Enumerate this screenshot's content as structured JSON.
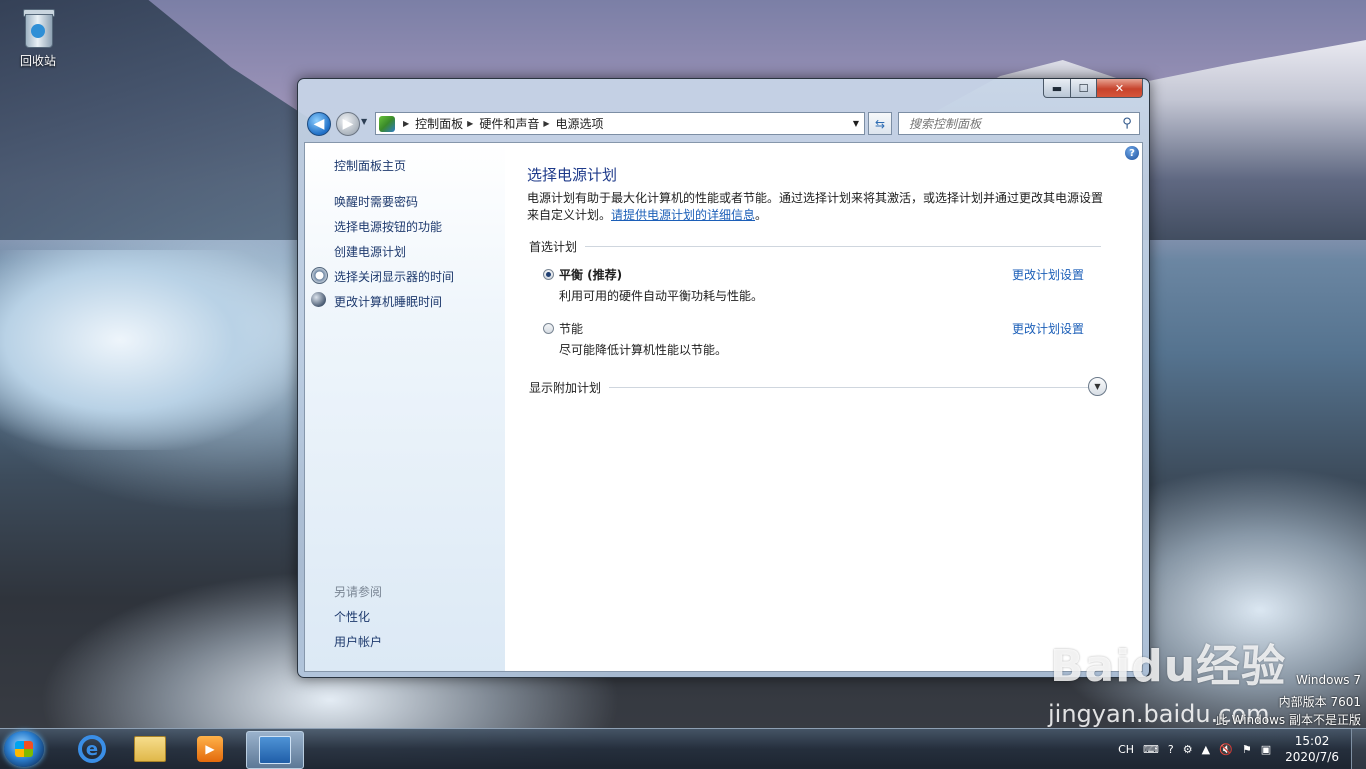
{
  "desktop": {
    "recycle_bin_label": "回收站"
  },
  "window": {
    "caption_buttons": {
      "minimize": "▬",
      "maximize": "☐",
      "close": "✕"
    },
    "address": {
      "crumbs": [
        "控制面板",
        "硬件和声音",
        "电源选项"
      ],
      "separator": "▶"
    },
    "search": {
      "placeholder": "搜索控制面板"
    },
    "help_symbol": "?"
  },
  "sidebar": {
    "home": "控制面板主页",
    "links": [
      "唤醒时需要密码",
      "选择电源按钮的功能",
      "创建电源计划",
      "选择关闭显示器的时间",
      "更改计算机睡眠时间"
    ],
    "see_also_title": "另请参阅",
    "see_also": [
      "个性化",
      "用户帐户"
    ]
  },
  "main": {
    "title": "选择电源计划",
    "description": "电源计划有助于最大化计算机的性能或者节能。通过选择计划来将其激活，或选择计划并通过更改其电源设置来自定义计划。",
    "description_link": "请提供电源计划的详细信息",
    "description_end": "。",
    "preferred_group": "首选计划",
    "plans": [
      {
        "name": "平衡 (推荐)",
        "desc": "利用可用的硬件自动平衡功耗与性能。",
        "link": "更改计划设置",
        "selected": true
      },
      {
        "name": "节能",
        "desc": "尽可能降低计算机性能以节能。",
        "link": "更改计划设置",
        "selected": false
      }
    ],
    "additional_group": "显示附加计划"
  },
  "watermark": {
    "logo": "Baidu经验",
    "url": "jingyan.baidu.com",
    "os_lines": [
      "Windows 7",
      "内部版本 7601",
      "此 Windows 副本不是正版"
    ]
  },
  "taskbar": {
    "lang": "CH",
    "time": "15:02",
    "date": "2020/7/6"
  },
  "icons": [
    "recycle-bin-icon",
    "back-arrow-icon",
    "forward-arrow-icon",
    "control-panel-icon",
    "refresh-icon",
    "search-icon",
    "help-icon",
    "clock-icon",
    "moon-icon",
    "expand-chevron-icon",
    "start-orb-icon",
    "ie-icon",
    "explorer-folder-icon",
    "media-player-icon",
    "power-options-icon"
  ]
}
